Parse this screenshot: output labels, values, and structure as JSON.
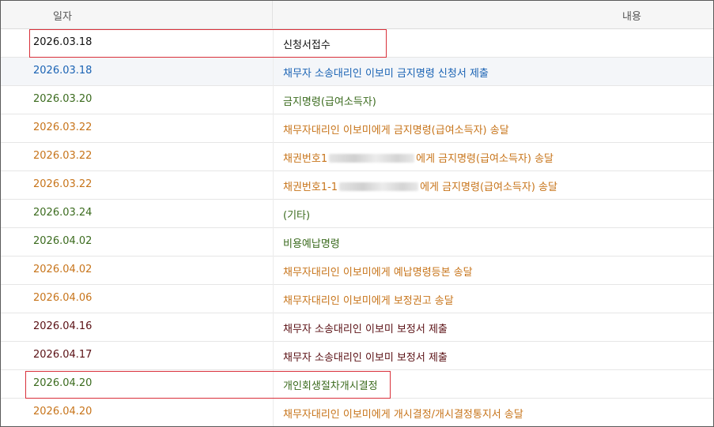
{
  "header": {
    "date_label": "일자",
    "content_label": "내용"
  },
  "rows": [
    {
      "date": "2026.03.18",
      "content": "신청서접수",
      "color": "#111111",
      "bold": false
    },
    {
      "date": "2026.03.18",
      "content": "채무자 소송대리인 이보미 금지명령 신청서 제출",
      "color": "#1a63b4",
      "bold": false
    },
    {
      "date": "2026.03.20",
      "content": "금지명령(급여소득자)",
      "color": "#3b6b1e",
      "bold": false
    },
    {
      "date": "2026.03.22",
      "content": "채무자대리인 이보미에게 금지명령(급여소득자) 송달",
      "color": "#c7741a",
      "bold": false
    },
    {
      "date": "2026.03.22",
      "content_pre": "채권번호1",
      "content_post": "에게 금지명령(급여소득자) 송달",
      "color": "#c7741a",
      "bold": false
    },
    {
      "date": "2026.03.22",
      "content_pre": "채권번호1-1",
      "content_post": "에게 금지명령(급여소득자) 송달",
      "color": "#c7741a",
      "bold": false
    },
    {
      "date": "2026.03.24",
      "content": "(기타)",
      "color": "#3b6b1e",
      "bold": false
    },
    {
      "date": "2026.04.02",
      "content": "비용예납명령",
      "color": "#3b6b1e",
      "bold": false
    },
    {
      "date": "2026.04.02",
      "content": "채무자대리인 이보미에게 예납명령등본 송달",
      "color": "#c7741a",
      "bold": false
    },
    {
      "date": "2026.04.06",
      "content": "채무자대리인 이보미에게 보정권고 송달",
      "color": "#c7741a",
      "bold": false
    },
    {
      "date": "2026.04.16",
      "content": "채무자 소송대리인 이보미 보정서 제출",
      "color": "#5a1014",
      "bold": false
    },
    {
      "date": "2026.04.17",
      "content": "채무자 소송대리인 이보미 보정서 제출",
      "color": "#5a1014",
      "bold": false
    },
    {
      "date": "2026.04.20",
      "content": "개인회생절차개시결정",
      "color": "#3b6b1e",
      "bold": false
    },
    {
      "date": "2026.04.20",
      "content": "채무자대리인 이보미에게 개시결정/개시결정통지서 송달",
      "color": "#c7741a",
      "bold": false
    }
  ],
  "highlight_color": "#d9303a"
}
